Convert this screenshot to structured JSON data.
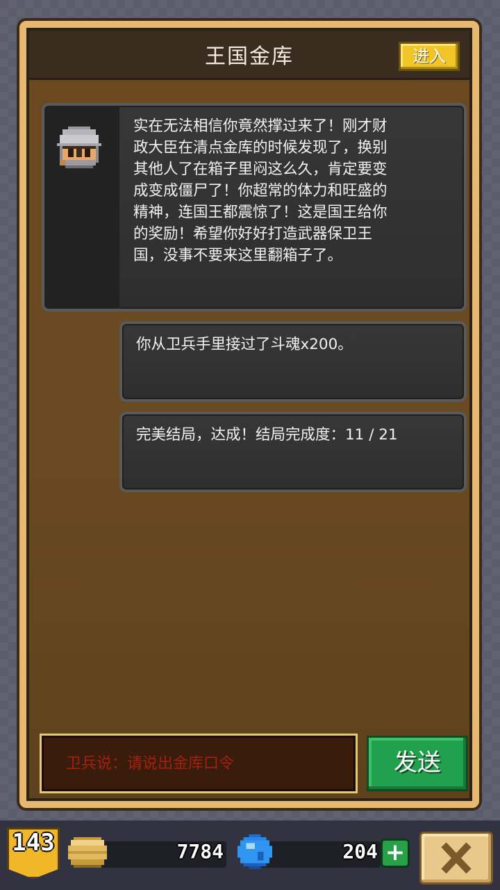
{
  "dialog": {
    "title": "王国金库",
    "enter_label": "进入"
  },
  "messages": [
    {
      "speaker_icon": "knight-avatar-icon",
      "text": "实在无法相信你竟然撑过来了！刚才财\n政大臣在清点金库的时候发现了，换别\n其他人了在箱子里闷这么久，肯定要变\n成变成僵尸了！你超常的体力和旺盛的\n精神，连国王都震惊了！这是国王给你\n的奖励！希望你好好打造武器保卫王\n国，没事不要来这里翻箱子了。"
    },
    {
      "text": "你从卫兵手里接过了斗魂x200。"
    },
    {
      "text": "完美结局，达成！结局完成度：11 / 21"
    }
  ],
  "input": {
    "placeholder": "卫兵说：请说出金库口令",
    "value": ""
  },
  "send_label": "发送",
  "status_bar": {
    "level": "143",
    "coins": "7784",
    "gems": "204",
    "plus_label": "+"
  },
  "colors": {
    "accent_gold": "#f1c427",
    "send_green": "#21a04e",
    "prompt_red": "#a6200f"
  }
}
